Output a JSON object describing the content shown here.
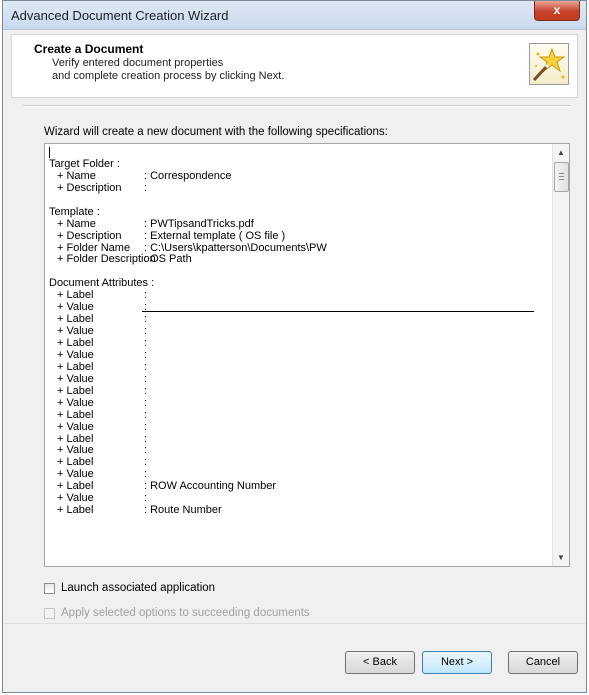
{
  "window": {
    "title": "Advanced Document Creation Wizard",
    "close_glyph": "x"
  },
  "header": {
    "title": "Create a Document",
    "line1": "Verify entered document properties",
    "line2": "and complete creation process by clicking Next.",
    "icon": "wizard-wand-icon"
  },
  "intro": "Wizard will create a new document with the following specifications:",
  "spec_lines": [
    {
      "type": "caret",
      "key": "",
      "value": ""
    },
    {
      "type": "section",
      "key": "Target Folder :",
      "value": ""
    },
    {
      "type": "item",
      "key": "+ Name",
      "value": ": Correspondence"
    },
    {
      "type": "item",
      "key": "+ Description",
      "value": ":"
    },
    {
      "type": "blank",
      "key": "",
      "value": ""
    },
    {
      "type": "section",
      "key": "Template :",
      "value": ""
    },
    {
      "type": "item",
      "key": "+ Name",
      "value": ": PWTipsandTricks.pdf"
    },
    {
      "type": "item",
      "key": "+ Description",
      "value": ": External template ( OS file )"
    },
    {
      "type": "item",
      "key": "+ Folder Name",
      "value": ": C:\\Users\\kpatterson\\Documents\\PW"
    },
    {
      "type": "item",
      "key": "+ Folder Description",
      "value": ": OS Path"
    },
    {
      "type": "blank",
      "key": "",
      "value": ""
    },
    {
      "type": "section",
      "key": "Document Attributes :",
      "value": ""
    },
    {
      "type": "item",
      "key": "+ Label",
      "value": ":"
    },
    {
      "type": "item",
      "key": "+ Value",
      "value": ":",
      "underline": true
    },
    {
      "type": "item",
      "key": "+ Label",
      "value": ":"
    },
    {
      "type": "item",
      "key": "+ Value",
      "value": ":"
    },
    {
      "type": "item",
      "key": "+ Label",
      "value": ":"
    },
    {
      "type": "item",
      "key": "+ Value",
      "value": ":"
    },
    {
      "type": "item",
      "key": "+ Label",
      "value": ":"
    },
    {
      "type": "item",
      "key": "+ Value",
      "value": ":"
    },
    {
      "type": "item",
      "key": "+ Label",
      "value": ":"
    },
    {
      "type": "item",
      "key": "+ Value",
      "value": ":"
    },
    {
      "type": "item",
      "key": "+ Label",
      "value": ":"
    },
    {
      "type": "item",
      "key": "+ Value",
      "value": ":"
    },
    {
      "type": "item",
      "key": "+ Label",
      "value": ":"
    },
    {
      "type": "item",
      "key": "+ Value",
      "value": ":"
    },
    {
      "type": "item",
      "key": "+ Label",
      "value": ":"
    },
    {
      "type": "item",
      "key": "+ Value",
      "value": ":"
    },
    {
      "type": "item",
      "key": "+ Label",
      "value": ": ROW Accounting Number"
    },
    {
      "type": "item",
      "key": "+ Value",
      "value": ":"
    },
    {
      "type": "item",
      "key": "+ Label",
      "value": ": Route Number"
    }
  ],
  "options": {
    "launch_label": "Launch associated application",
    "launch_checked": false,
    "apply_label": "Apply selected options to succeeding documents",
    "apply_checked": false,
    "apply_enabled": false
  },
  "buttons": {
    "back": "< Back",
    "next": "Next >",
    "cancel": "Cancel"
  },
  "scrollbar": {
    "up_glyph": "▲",
    "down_glyph": "▼"
  }
}
